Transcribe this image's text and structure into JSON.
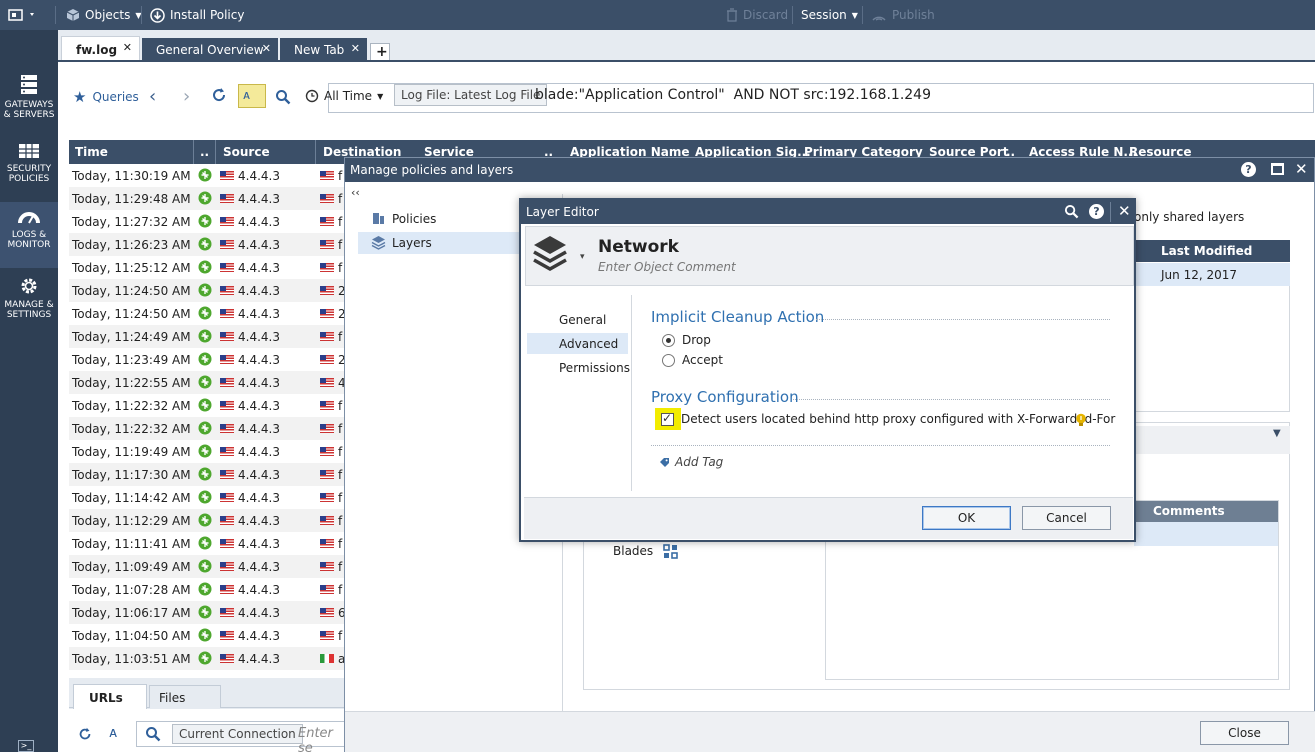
{
  "topbar": {
    "menu_icon": "app-menu-icon",
    "objects_label": "Objects",
    "install_policy_label": "Install Policy",
    "discard_label": "Discard",
    "session_label": "Session",
    "publish_label": "Publish"
  },
  "tabs": [
    {
      "label": "fw.log",
      "active": true
    },
    {
      "label": "General Overview",
      "active": false
    },
    {
      "label": "New Tab",
      "active": false
    }
  ],
  "nav": [
    {
      "label1": "GATEWAYS",
      "label2": "& SERVERS",
      "icon": "servers-icon"
    },
    {
      "label1": "SECURITY",
      "label2": "POLICIES",
      "icon": "policies-icon"
    },
    {
      "label1": "LOGS &",
      "label2": "MONITOR",
      "icon": "gauge-icon",
      "active": true
    },
    {
      "label1": "MANAGE &",
      "label2": "SETTINGS",
      "icon": "gear-icon"
    }
  ],
  "querybar": {
    "queries_label": "Queries",
    "time_filter": "All Time",
    "log_file_chip": "Log File: Latest Log File",
    "query_text": "blade:\"Application Control\"  AND NOT src:192.168.1.249"
  },
  "log_table": {
    "columns": [
      "Time",
      "..",
      "Source",
      "Destination",
      "Service",
      "..",
      "Application Name",
      "Application Sig...",
      "Primary Category",
      "Source Port",
      "..",
      "Access Rule N...",
      "Resource"
    ],
    "rows": [
      {
        "time": "Today, 11:30:19 AM",
        "source": "4.4.4.3",
        "dest": "f"
      },
      {
        "time": "Today, 11:29:48 AM",
        "source": "4.4.4.3",
        "dest": "f"
      },
      {
        "time": "Today, 11:27:32 AM",
        "source": "4.4.4.3",
        "dest": "f"
      },
      {
        "time": "Today, 11:26:23 AM",
        "source": "4.4.4.3",
        "dest": "f"
      },
      {
        "time": "Today, 11:25:12 AM",
        "source": "4.4.4.3",
        "dest": "f"
      },
      {
        "time": "Today, 11:24:50 AM",
        "source": "4.4.4.3",
        "dest": "2"
      },
      {
        "time": "Today, 11:24:50 AM",
        "source": "4.4.4.3",
        "dest": "2"
      },
      {
        "time": "Today, 11:24:49 AM",
        "source": "4.4.4.3",
        "dest": "f"
      },
      {
        "time": "Today, 11:23:49 AM",
        "source": "4.4.4.3",
        "dest": "2"
      },
      {
        "time": "Today, 11:22:55 AM",
        "source": "4.4.4.3",
        "dest": "4"
      },
      {
        "time": "Today, 11:22:32 AM",
        "source": "4.4.4.3",
        "dest": "f"
      },
      {
        "time": "Today, 11:22:32 AM",
        "source": "4.4.4.3",
        "dest": "f"
      },
      {
        "time": "Today, 11:19:49 AM",
        "source": "4.4.4.3",
        "dest": "f"
      },
      {
        "time": "Today, 11:17:30 AM",
        "source": "4.4.4.3",
        "dest": "f"
      },
      {
        "time": "Today, 11:14:42 AM",
        "source": "4.4.4.3",
        "dest": "f"
      },
      {
        "time": "Today, 11:12:29 AM",
        "source": "4.4.4.3",
        "dest": "f"
      },
      {
        "time": "Today, 11:11:41 AM",
        "source": "4.4.4.3",
        "dest": "f"
      },
      {
        "time": "Today, 11:09:49 AM",
        "source": "4.4.4.3",
        "dest": "f"
      },
      {
        "time": "Today, 11:07:28 AM",
        "source": "4.4.4.3",
        "dest": "f"
      },
      {
        "time": "Today, 11:06:17 AM",
        "source": "4.4.4.3",
        "dest": "6"
      },
      {
        "time": "Today, 11:04:50 AM",
        "source": "4.4.4.3",
        "dest": "f"
      },
      {
        "time": "Today, 11:03:51 AM",
        "source": "4.4.4.3",
        "dest": "a",
        "dest_flag": "it"
      }
    ]
  },
  "bottom": {
    "tab_urls": "URLs",
    "tab_files": "Files",
    "chip": "Current Connection",
    "search_placeholder": "Enter se"
  },
  "manage_window": {
    "title": "Manage policies and layers",
    "collapse": "‹‹",
    "tree": [
      {
        "label": "Policies",
        "icon": "policies-tree-icon"
      },
      {
        "label": "Layers",
        "icon": "layers-tree-icon",
        "selected": true
      }
    ],
    "shared_filter": "only shared layers",
    "table_col_last_modified": "Last Modified",
    "table_cell_date": "Jun 12, 2017",
    "comments_header": "Comments",
    "blades_label": "Blades",
    "close_button": "Close"
  },
  "layer_editor": {
    "title": "Layer Editor",
    "name": "Network",
    "comment_placeholder": "Enter Object Comment",
    "nav": [
      "General",
      "Advanced",
      "Permissions"
    ],
    "nav_selected": "Advanced",
    "section_cleanup": "Implicit Cleanup Action",
    "radio_drop": "Drop",
    "radio_accept": "Accept",
    "radio_selected": "Drop",
    "section_proxy": "Proxy Configuration",
    "proxy_checkbox_label": "Detect users located behind http proxy configured with X-Forwarded-For",
    "proxy_checked": true,
    "add_tag": "Add Tag",
    "ok_button": "OK",
    "cancel_button": "Cancel"
  },
  "colors": {
    "header_bg": "#3b4f68",
    "nav_bg": "#2e3f54",
    "accent_blue": "#2f70b0",
    "highlight_yellow": "#f2ec00",
    "status_green": "#4ea72e"
  }
}
